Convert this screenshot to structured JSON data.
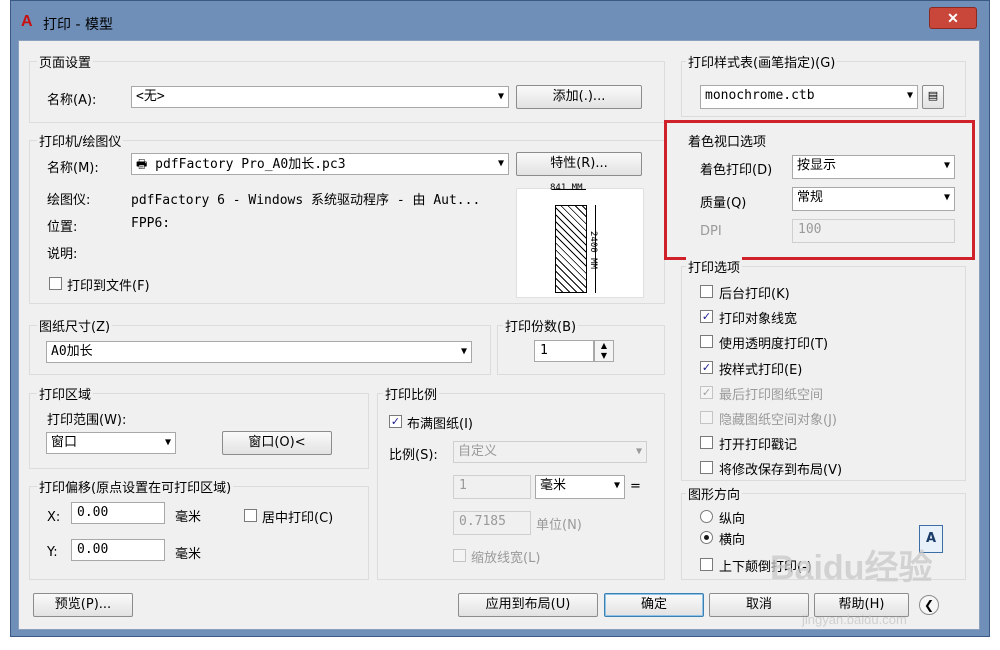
{
  "window": {
    "title": "打印 - 模型",
    "app_icon": "A",
    "close_icon": "✕"
  },
  "page_setup": {
    "group_label": "页面设置",
    "name_label": "名称(A):",
    "name_value": "<无>",
    "add_button": "添加(.)..."
  },
  "printer": {
    "group_label": "打印机/绘图仪",
    "name_label": "名称(M):",
    "name_value": "pdfFactory Pro_A0加长.pc3",
    "properties_button": "特性(R)...",
    "plotter_label": "绘图仪:",
    "plotter_value": "pdfFactory 6 - Windows 系统驱动程序 - 由 Aut...",
    "location_label": "位置:",
    "location_value": "FPP6:",
    "description_label": "说明:",
    "print_to_file": "打印到文件(F)",
    "preview_width": "841 MM",
    "preview_height": "2400 MM"
  },
  "paper_size": {
    "group_label": "图纸尺寸(Z)",
    "value": "A0加长"
  },
  "copies": {
    "group_label": "打印份数(B)",
    "value": "1"
  },
  "plot_area": {
    "group_label": "打印区域",
    "range_label": "打印范围(W):",
    "range_value": "窗口",
    "window_button": "窗口(O)<"
  },
  "plot_offset": {
    "group_label": "打印偏移(原点设置在可打印区域)",
    "x_label": "X:",
    "x_value": "0.00",
    "x_unit": "毫米",
    "y_label": "Y:",
    "y_value": "0.00",
    "y_unit": "毫米",
    "center_plot": "居中打印(C)"
  },
  "plot_scale": {
    "group_label": "打印比例",
    "fit_to_paper": "布满图纸(I)",
    "scale_label": "比例(S):",
    "scale_value": "自定义",
    "value1": "1",
    "unit1": "毫米",
    "equals": "=",
    "value2": "0.7185",
    "unit2": "单位(N)",
    "scale_lineweights": "缩放线宽(L)"
  },
  "plot_style_table": {
    "group_label": "打印样式表(画笔指定)(G)",
    "value": "monochrome.ctb"
  },
  "shaded_viewport": {
    "group_label": "着色视口选项",
    "shade_label": "着色打印(D)",
    "shade_value": "按显示",
    "quality_label": "质量(Q)",
    "quality_value": "常规",
    "dpi_label": "DPI",
    "dpi_value": "100"
  },
  "plot_options": {
    "group_label": "打印选项",
    "items": [
      {
        "label": "后台打印(K)",
        "checked": false,
        "disabled": false
      },
      {
        "label": "打印对象线宽",
        "checked": true,
        "disabled": false
      },
      {
        "label": "使用透明度打印(T)",
        "checked": false,
        "disabled": false
      },
      {
        "label": "按样式打印(E)",
        "checked": true,
        "disabled": false
      },
      {
        "label": "最后打印图纸空间",
        "checked": true,
        "disabled": true
      },
      {
        "label": "隐藏图纸空间对象(J)",
        "checked": false,
        "disabled": true
      },
      {
        "label": "打开打印戳记",
        "checked": false,
        "disabled": false
      },
      {
        "label": "将修改保存到布局(V)",
        "checked": false,
        "disabled": false
      }
    ]
  },
  "orientation": {
    "group_label": "图形方向",
    "portrait": "纵向",
    "landscape": "横向",
    "upside_down": "上下颠倒打印(-)",
    "icon_letter": "A"
  },
  "footer": {
    "preview_button": "预览(P)...",
    "apply_button": "应用到布局(U)",
    "ok_button": "确定",
    "cancel_button": "取消",
    "help_button": "帮助(H)"
  },
  "watermark": {
    "text": "Baidu经验",
    "url": "jingyan.baidu.com"
  }
}
